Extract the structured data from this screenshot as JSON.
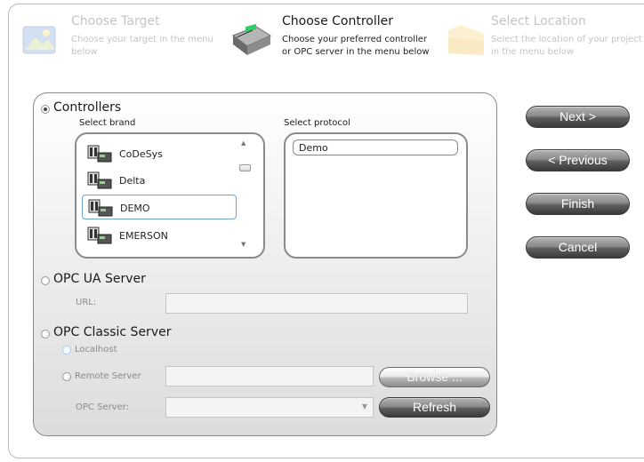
{
  "steps": [
    {
      "title": "Choose Target",
      "desc1": "Choose your target in the menu",
      "desc2": "below",
      "state": "dim",
      "icon": "target-image-icon"
    },
    {
      "title": "Choose Controller",
      "desc1": "Choose your preferred controller",
      "desc2": "or OPC server in the menu below",
      "state": "active",
      "icon": "controller-device-icon"
    },
    {
      "title": "Select Location",
      "desc1": "Select the location of your project",
      "desc2": "in the menu below",
      "state": "dim",
      "icon": "folder-icon"
    }
  ],
  "controllers": {
    "label": "Controllers",
    "selected": true,
    "brand_label": "Select brand",
    "protocol_label": "Select protocol",
    "brands": [
      {
        "label": "CoDeSys",
        "icon": "plc-icon"
      },
      {
        "label": "Delta",
        "icon": "plc-icon"
      },
      {
        "label": "DEMO",
        "icon": "plc-icon",
        "selected": true
      },
      {
        "label": "EMERSON",
        "icon": "plc-icon"
      }
    ],
    "protocols": [
      "Demo"
    ]
  },
  "opc_ua": {
    "label": "OPC UA Server",
    "url_label": "URL:",
    "url_value": ""
  },
  "opc_classic": {
    "label": "OPC Classic Server",
    "localhost_label": "Localhost",
    "remote_label": "Remote Server",
    "remote_value": "",
    "opc_server_label": "OPC Server:",
    "opc_server_value": "",
    "browse_label": "Browse ...",
    "refresh_label": "Refresh"
  },
  "nav": {
    "next": "Next >",
    "previous": "< Previous",
    "finish": "Finish",
    "cancel": "Cancel"
  },
  "colors": {
    "button_dark": "#3a3a3a",
    "selection_border": "#6aa8d6",
    "disabled_radio": "#9fd2ee"
  }
}
